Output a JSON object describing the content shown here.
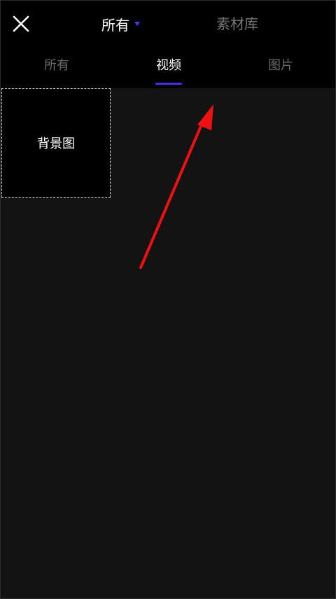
{
  "header": {
    "close_icon": "close-icon",
    "source_label": "所有",
    "source_caret_icon": "caret-down-icon",
    "library_label": "素材库"
  },
  "tabs": [
    {
      "label": "所有",
      "active": false
    },
    {
      "label": "视频",
      "active": true
    },
    {
      "label": "图片",
      "active": false
    }
  ],
  "content": {
    "background_tile_label": "背景图"
  },
  "colors": {
    "accent": "#4a2ee8",
    "annotation_arrow": "#ee1111",
    "background": "#131313",
    "header": "#000000"
  }
}
